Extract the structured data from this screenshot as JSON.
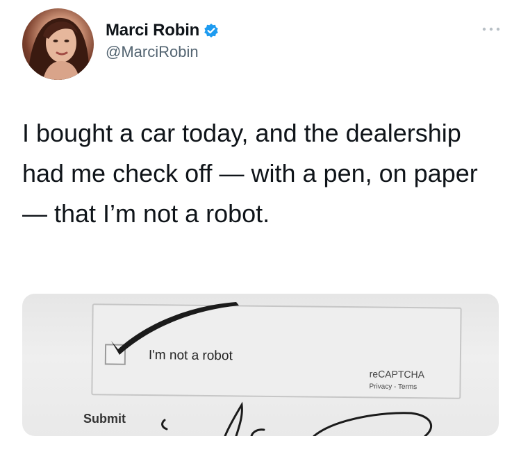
{
  "author": {
    "display_name": "Marci Robin",
    "handle": "@MarciRobin",
    "verified": true
  },
  "tweet": {
    "text": "I bought a car today, and the dealership had me check off — with a pen, on paper — that I’m not a robot."
  },
  "media": {
    "captcha_label": "I'm not a robot",
    "recaptcha_brand": "reCAPTCHA",
    "recaptcha_links": "Privacy - Terms",
    "submit_label": "Submit"
  },
  "colors": {
    "verified_badge": "#1d9bf0",
    "handle_text": "#536471",
    "more_icon": "#b8c0c6"
  },
  "icons": [
    "verified-badge-icon",
    "more-options-icon"
  ]
}
